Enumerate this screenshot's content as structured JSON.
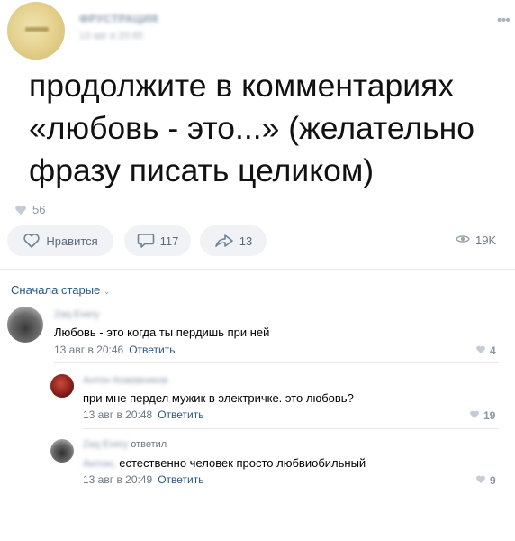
{
  "post": {
    "author": "ФРУСТРАЦИЯ",
    "date": "13 авг в 20:45",
    "text": "продолжите в комментариях «любовь - это...» (желательно фразу писать целиком)",
    "likes_count": "56"
  },
  "actions": {
    "like_label": "Нравится",
    "comments_count": "117",
    "shares_count": "13",
    "views_count": "19K"
  },
  "comments_sort": "Сначала старые",
  "comments": [
    {
      "author": "Zaq Every",
      "text": "Любовь - это когда ты пердишь при ней",
      "date": "13 авг в 20:46",
      "reply_label": "Ответить",
      "likes": "4"
    },
    {
      "author": "Антон Кожевников",
      "text": "при мне пердел мужик в электричке. это любовь?",
      "date": "13 авг в 20:48",
      "reply_label": "Ответить",
      "likes": "19"
    },
    {
      "author": "Zaq Every",
      "replied_word": "ответил",
      "addressee": "Антон,",
      "text": "естественно человек просто любвиобильный",
      "date": "13 авг в 20:49",
      "reply_label": "Ответить",
      "likes": "9"
    }
  ],
  "colors": {
    "link": "#2a5885",
    "meta": "#6d7885",
    "button_bg": "#f0f2f5"
  }
}
